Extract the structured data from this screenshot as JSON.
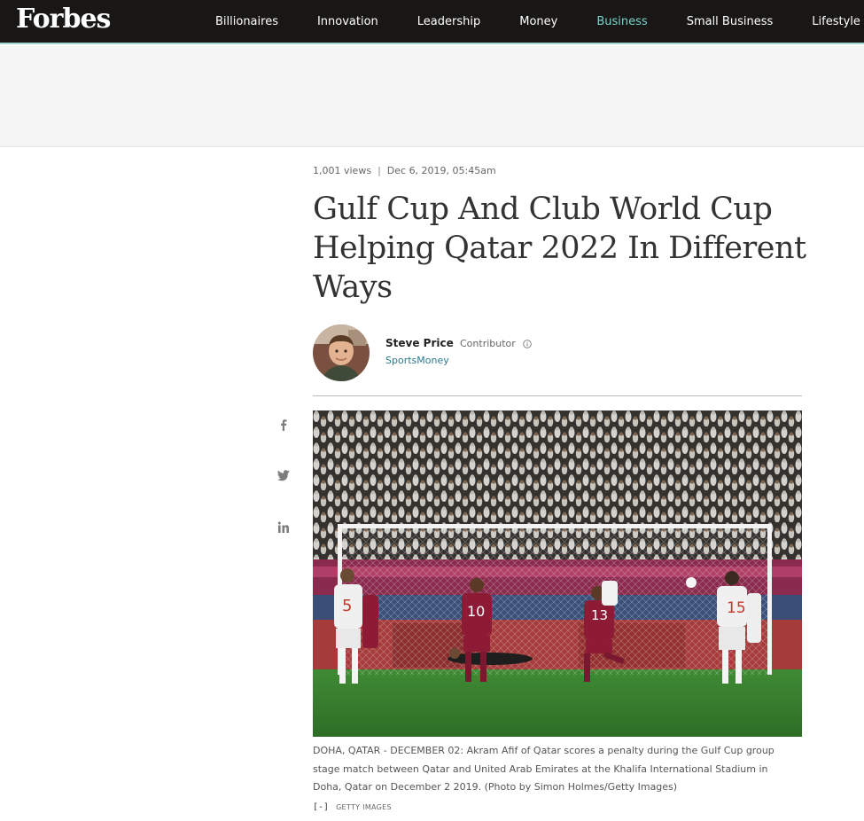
{
  "header": {
    "logo": "Forbes",
    "nav": [
      "Billionaires",
      "Innovation",
      "Leadership",
      "Money",
      "Business",
      "Small Business",
      "Lifestyle"
    ],
    "active": "Business",
    "active_color": "#7fd1c9"
  },
  "article": {
    "views": "1,001 views",
    "separator": "|",
    "date": "Dec 6, 2019, 05:45am",
    "headline": "Gulf Cup And Club World Cup Helping Qatar 2022 In Different Ways",
    "author": {
      "name": "Steve Price",
      "role": "Contributor",
      "channel": "SportsMoney",
      "channel_color": "#2b7a8c"
    },
    "share_icons": [
      "facebook-icon",
      "twitter-icon",
      "linkedin-icon"
    ],
    "photo": {
      "caption": "DOHA, QATAR - DECEMBER 02: Akram Afif of Qatar scores a penalty during the Gulf Cup group stage match between Qatar and United Arab Emirates at the Khalifa International Stadium in Doha, Qatar on December 2 2019. (Photo by Simon Holmes/Getty Images)",
      "collapse_label": "[-]",
      "credit": "GETTY IMAGES",
      "jersey_numbers": [
        "5",
        "10",
        "13",
        "15"
      ]
    }
  }
}
